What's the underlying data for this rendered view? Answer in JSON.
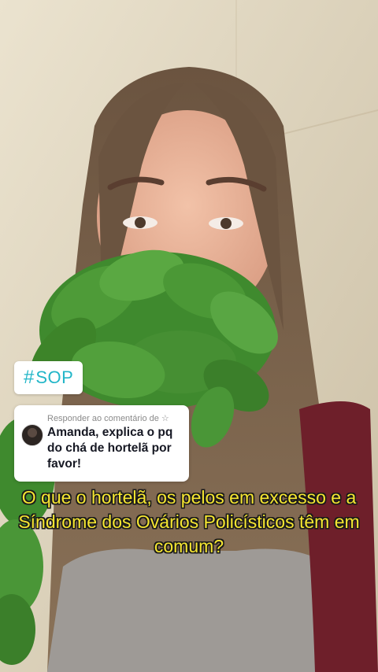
{
  "overlay": {
    "hashtag": {
      "symbol": "#",
      "text": "SOP",
      "color": "#22b6c8"
    },
    "reply": {
      "header": "Responder ao comentário de ☆",
      "text": "Amanda, explica o pq do chá de hortelã por favor!"
    },
    "caption": {
      "text": "O que o hortelã, os pelos em excesso e a Síndrome dos Ovários Policísticos têm em comum?",
      "color": "#f6e631"
    }
  }
}
